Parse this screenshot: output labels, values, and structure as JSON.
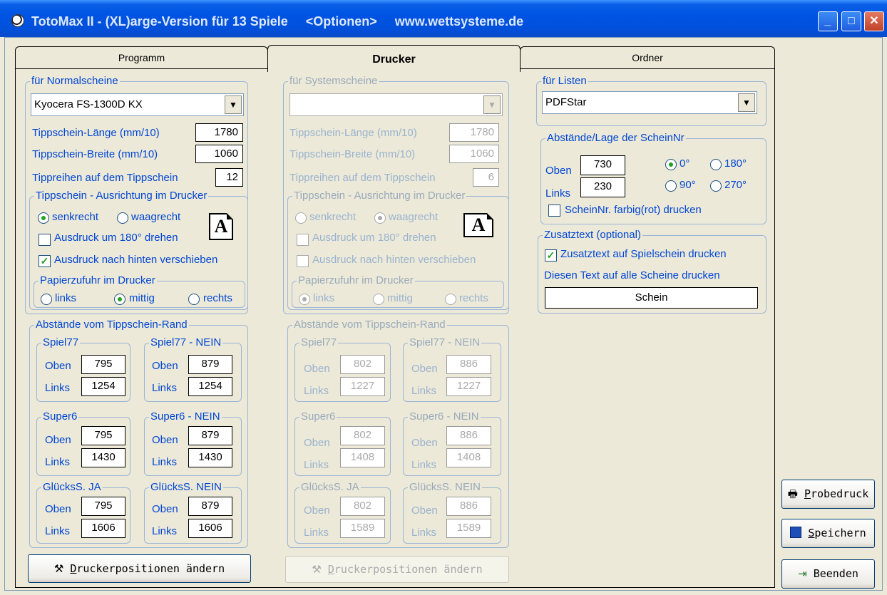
{
  "window": {
    "title": "TotoMax II - (XL)arge-Version für 13 Spiele     <Optionen>     www.wettsysteme.de",
    "controls": {
      "minimize": "_",
      "maximize": "□",
      "close": "✕"
    }
  },
  "tabs": [
    {
      "label": "Programm"
    },
    {
      "label": "Drucker"
    },
    {
      "label": "Ordner"
    }
  ],
  "normal": {
    "group_label": "für Normalscheine",
    "printer": "Kyocera FS-1300D KX",
    "laenge_label": "Tippschein-Länge  (mm/10)",
    "laenge": "1780",
    "breite_label": "Tippschein-Breite  (mm/10)",
    "breite": "1060",
    "reihen_label": "Tippreihen auf dem Tippschein",
    "reihen": "12",
    "ausrichtung_label": "Tippschein - Ausrichtung im Drucker",
    "senkrecht": "senkrecht",
    "waagrecht": "waagrecht",
    "drehen": "Ausdruck um 180° drehen",
    "verschieben": "Ausdruck nach hinten verschieben",
    "papier_label": "Papierzufuhr im Drucker",
    "links": "links",
    "mittig": "mittig",
    "rechts": "rechts",
    "abstaende_label": "Abstände vom Tippschein-Rand",
    "oben": "Oben",
    "links_short": "Links",
    "boxes": [
      {
        "name": "Spiel77",
        "oben": "795",
        "links": "1254"
      },
      {
        "name": "Spiel77 - NEIN",
        "oben": "879",
        "links": "1254"
      },
      {
        "name": "Super6",
        "oben": "795",
        "links": "1430"
      },
      {
        "name": "Super6 - NEIN",
        "oben": "879",
        "links": "1430"
      },
      {
        "name": "GlücksS. JA",
        "oben": "795",
        "links": "1606"
      },
      {
        "name": "GlücksS. NEIN",
        "oben": "879",
        "links": "1606"
      }
    ],
    "button": "Druckerpositionen ändern",
    "button_hotkey": "D",
    "button_rest": "ruckerpositionen ändern"
  },
  "system": {
    "group_label": "für Systemscheine",
    "printer": "",
    "laenge_label": "Tippschein-Länge  (mm/10)",
    "laenge": "1780",
    "breite_label": "Tippschein-Breite  (mm/10)",
    "breite": "1060",
    "reihen_label": "Tippreihen auf dem Tippschein",
    "reihen": "6",
    "ausrichtung_label": "Tippschein - Ausrichtung im Drucker",
    "senkrecht": "senkrecht",
    "waagrecht": "waagrecht",
    "drehen": "Ausdruck um 180° drehen",
    "verschieben": "Ausdruck nach hinten verschieben",
    "papier_label": "Papierzufuhr im Drucker",
    "links": "links",
    "mittig": "mittig",
    "rechts": "rechts",
    "abstaende_label": "Abstände vom Tippschein-Rand",
    "oben": "Oben",
    "links_short": "Links",
    "boxes": [
      {
        "name": "Spiel77",
        "oben": "802",
        "links": "1227"
      },
      {
        "name": "Spiel77 - NEIN",
        "oben": "886",
        "links": "1227"
      },
      {
        "name": "Super6",
        "oben": "802",
        "links": "1408"
      },
      {
        "name": "Super6 - NEIN",
        "oben": "886",
        "links": "1408"
      },
      {
        "name": "GlücksS. JA",
        "oben": "802",
        "links": "1589"
      },
      {
        "name": "GlücksS. NEIN",
        "oben": "886",
        "links": "1589"
      }
    ],
    "button_hotkey": "D",
    "button_rest": "ruckerpositionen ändern"
  },
  "listen": {
    "group_label": "für Listen",
    "printer": "PDFStar"
  },
  "scheinnr": {
    "group_label": "Abstände/Lage der ScheinNr",
    "oben_label": "Oben",
    "oben": "730",
    "links_label": "Links",
    "links": "230",
    "r0": "0°",
    "r180": "180°",
    "r90": "90°",
    "r270": "270°",
    "farbig": "ScheinNr. farbig(rot) drucken"
  },
  "zusatz": {
    "group_label": "Zusatztext (optional)",
    "check_label": "Zusatztext auf Spielschein drucken",
    "info": "Diesen Text auf alle Scheine drucken",
    "text": "Schein"
  },
  "side_buttons": {
    "probedruck_hotkey": "P",
    "probedruck_rest": "robedruck",
    "speichern_hotkey": "S",
    "speichern_rest": "peichern",
    "beenden": "Beenden"
  }
}
